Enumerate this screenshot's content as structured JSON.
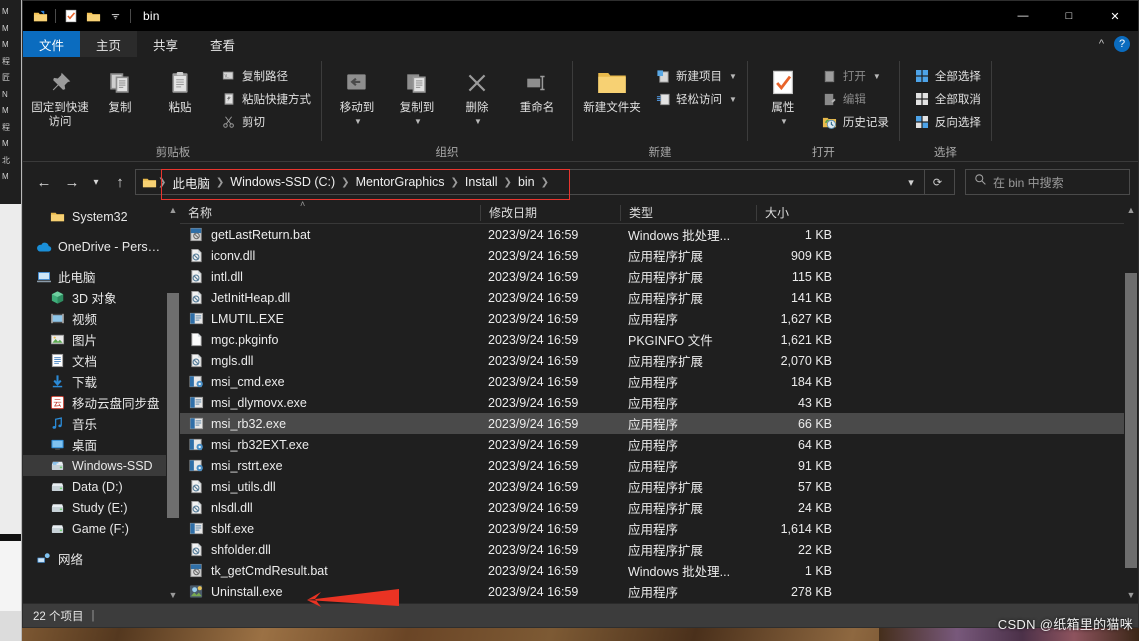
{
  "window": {
    "title": "bin",
    "quick_access_icons": [
      "folder-new-icon",
      "properties-check-icon",
      "folder-icon"
    ],
    "dropdown_icon": "chevron-down-icon",
    "controls": {
      "minimize": "—",
      "maximize": "□",
      "close": "✕"
    }
  },
  "tabs": [
    {
      "label": "文件",
      "kind": "file"
    },
    {
      "label": "主页",
      "kind": "active"
    },
    {
      "label": "共享",
      "kind": "normal"
    },
    {
      "label": "查看",
      "kind": "normal"
    }
  ],
  "tabbar_right": {
    "collapse_icon": "chevron-up-icon",
    "help_label": "?"
  },
  "ribbon": {
    "groups": [
      {
        "label": "剪贴板",
        "big": [
          {
            "label": "固定到快速访问",
            "icon": "pin-icon"
          },
          {
            "label": "复制",
            "icon": "copy-icon"
          },
          {
            "label": "粘贴",
            "icon": "paste-icon"
          }
        ],
        "small": [
          {
            "label": "复制路径",
            "icon": "copy-path-icon"
          },
          {
            "label": "粘贴快捷方式",
            "icon": "paste-shortcut-icon"
          },
          {
            "label": "剪切",
            "icon": "scissors-icon"
          }
        ]
      },
      {
        "label": "组织",
        "big": [
          {
            "label": "移动到",
            "icon": "move-to-icon",
            "caret": true
          },
          {
            "label": "复制到",
            "icon": "copy-to-icon",
            "caret": true
          },
          {
            "label": "删除",
            "icon": "delete-x-icon",
            "caret": true
          },
          {
            "label": "重命名",
            "icon": "rename-icon"
          }
        ]
      },
      {
        "label": "新建",
        "big": [
          {
            "label": "新建文件夹",
            "icon": "new-folder-icon"
          }
        ],
        "small": [
          {
            "label": "新建项目",
            "icon": "new-item-icon",
            "caret": true
          },
          {
            "label": "轻松访问",
            "icon": "easy-access-icon",
            "caret": true
          }
        ]
      },
      {
        "label": "打开",
        "big": [
          {
            "label": "属性",
            "icon": "properties-icon",
            "caret": true
          }
        ],
        "small": [
          {
            "label": "打开",
            "icon": "open-icon",
            "caret": true,
            "dim": true
          },
          {
            "label": "编辑",
            "icon": "edit-icon",
            "dim": true
          },
          {
            "label": "历史记录",
            "icon": "history-icon"
          }
        ]
      },
      {
        "label": "选择",
        "small": [
          {
            "label": "全部选择",
            "icon": "select-all-icon"
          },
          {
            "label": "全部取消",
            "icon": "select-none-icon"
          },
          {
            "label": "反向选择",
            "icon": "invert-selection-icon"
          }
        ]
      }
    ]
  },
  "address": {
    "back_icon": "arrow-left-icon",
    "forward_icon": "arrow-right-icon",
    "recent_icon": "chevron-down-icon",
    "up_icon": "arrow-up-icon",
    "folder_icon": "folder-icon",
    "crumbs": [
      "此电脑",
      "Windows-SSD (C:)",
      "MentorGraphics",
      "Install",
      "bin"
    ],
    "dropdown_icon": "chevron-down-icon",
    "refresh_icon": "refresh-icon",
    "highlight_color": "#e8352e"
  },
  "search": {
    "icon": "search-icon",
    "placeholder": "在 bin 中搜索",
    "value": ""
  },
  "sidebar": {
    "items": [
      {
        "label": "System32",
        "icon": "folder-icon",
        "indent": 1
      },
      {
        "label": "OneDrive - Pers…",
        "icon": "onedrive-icon",
        "indent": 0,
        "gap_before": true
      },
      {
        "label": "此电脑",
        "icon": "this-pc-icon",
        "indent": 0,
        "gap_before": true
      },
      {
        "label": "3D 对象",
        "icon": "3d-objects-icon",
        "indent": 1
      },
      {
        "label": "视频",
        "icon": "videos-icon",
        "indent": 1
      },
      {
        "label": "图片",
        "icon": "pictures-icon",
        "indent": 1
      },
      {
        "label": "文档",
        "icon": "documents-icon",
        "indent": 1
      },
      {
        "label": "下载",
        "icon": "downloads-icon",
        "indent": 1
      },
      {
        "label": "移动云盘同步盘",
        "icon": "cloud-sync-icon",
        "indent": 1
      },
      {
        "label": "音乐",
        "icon": "music-icon",
        "indent": 1
      },
      {
        "label": "桌面",
        "icon": "desktop-icon",
        "indent": 1
      },
      {
        "label": "Windows-SSD",
        "icon": "drive-system-icon",
        "indent": 1,
        "selected": true
      },
      {
        "label": "Data (D:)",
        "icon": "drive-icon",
        "indent": 1
      },
      {
        "label": "Study (E:)",
        "icon": "drive-icon",
        "indent": 1
      },
      {
        "label": "Game (F:)",
        "icon": "drive-icon",
        "indent": 1
      },
      {
        "label": "网络",
        "icon": "network-icon",
        "indent": 0,
        "gap_before": true
      }
    ],
    "scroll_up_icon": "chevron-up-icon",
    "scroll_down_icon": "chevron-down-icon"
  },
  "filelist": {
    "columns": [
      "名称",
      "修改日期",
      "类型",
      "大小"
    ],
    "sort_indicator": "˄",
    "rows": [
      {
        "name": "getLastReturn.bat",
        "date": "2023/9/24 16:59",
        "type": "Windows 批处理...",
        "size": "1 KB",
        "icon": "bat-file-icon"
      },
      {
        "name": "iconv.dll",
        "date": "2023/9/24 16:59",
        "type": "应用程序扩展",
        "size": "909 KB",
        "icon": "dll-file-icon"
      },
      {
        "name": "intl.dll",
        "date": "2023/9/24 16:59",
        "type": "应用程序扩展",
        "size": "115 KB",
        "icon": "dll-file-icon"
      },
      {
        "name": "JetInitHeap.dll",
        "date": "2023/9/24 16:59",
        "type": "应用程序扩展",
        "size": "141 KB",
        "icon": "dll-file-icon"
      },
      {
        "name": "LMUTIL.EXE",
        "date": "2023/9/24 16:59",
        "type": "应用程序",
        "size": "1,627 KB",
        "icon": "exe-file-icon"
      },
      {
        "name": "mgc.pkginfo",
        "date": "2023/9/24 16:59",
        "type": "PKGINFO 文件",
        "size": "1,621 KB",
        "icon": "blank-file-icon"
      },
      {
        "name": "mgls.dll",
        "date": "2023/9/24 16:59",
        "type": "应用程序扩展",
        "size": "2,070 KB",
        "icon": "dll-file-icon"
      },
      {
        "name": "msi_cmd.exe",
        "date": "2023/9/24 16:59",
        "type": "应用程序",
        "size": "184 KB",
        "icon": "exe-gear-icon"
      },
      {
        "name": "msi_dlymovx.exe",
        "date": "2023/9/24 16:59",
        "type": "应用程序",
        "size": "43 KB",
        "icon": "exe-file-icon"
      },
      {
        "name": "msi_rb32.exe",
        "date": "2023/9/24 16:59",
        "type": "应用程序",
        "size": "66 KB",
        "icon": "exe-file-icon",
        "selected": true
      },
      {
        "name": "msi_rb32EXT.exe",
        "date": "2023/9/24 16:59",
        "type": "应用程序",
        "size": "64 KB",
        "icon": "exe-gear-icon"
      },
      {
        "name": "msi_rstrt.exe",
        "date": "2023/9/24 16:59",
        "type": "应用程序",
        "size": "91 KB",
        "icon": "exe-gear-icon"
      },
      {
        "name": "msi_utils.dll",
        "date": "2023/9/24 16:59",
        "type": "应用程序扩展",
        "size": "57 KB",
        "icon": "dll-file-icon"
      },
      {
        "name": "nlsdl.dll",
        "date": "2023/9/24 16:59",
        "type": "应用程序扩展",
        "size": "24 KB",
        "icon": "dll-file-icon"
      },
      {
        "name": "sblf.exe",
        "date": "2023/9/24 16:59",
        "type": "应用程序",
        "size": "1,614 KB",
        "icon": "exe-file-icon"
      },
      {
        "name": "shfolder.dll",
        "date": "2023/9/24 16:59",
        "type": "应用程序扩展",
        "size": "22 KB",
        "icon": "dll-file-icon"
      },
      {
        "name": "tk_getCmdResult.bat",
        "date": "2023/9/24 16:59",
        "type": "Windows 批处理...",
        "size": "1 KB",
        "icon": "bat-file-icon"
      },
      {
        "name": "Uninstall.exe",
        "date": "2023/9/24 16:59",
        "type": "应用程序",
        "size": "278 KB",
        "icon": "uninstall-icon"
      }
    ],
    "scroll_up_icon": "chevron-up-icon",
    "scroll_down_icon": "chevron-down-icon"
  },
  "statusbar": {
    "count": "22 个项目",
    "separator": "|"
  },
  "annotations": {
    "arrow_color": "#e8352e",
    "arrow_target": "Uninstall.exe"
  },
  "watermark": {
    "text": "CSDN @纸箱里的猫咪"
  }
}
